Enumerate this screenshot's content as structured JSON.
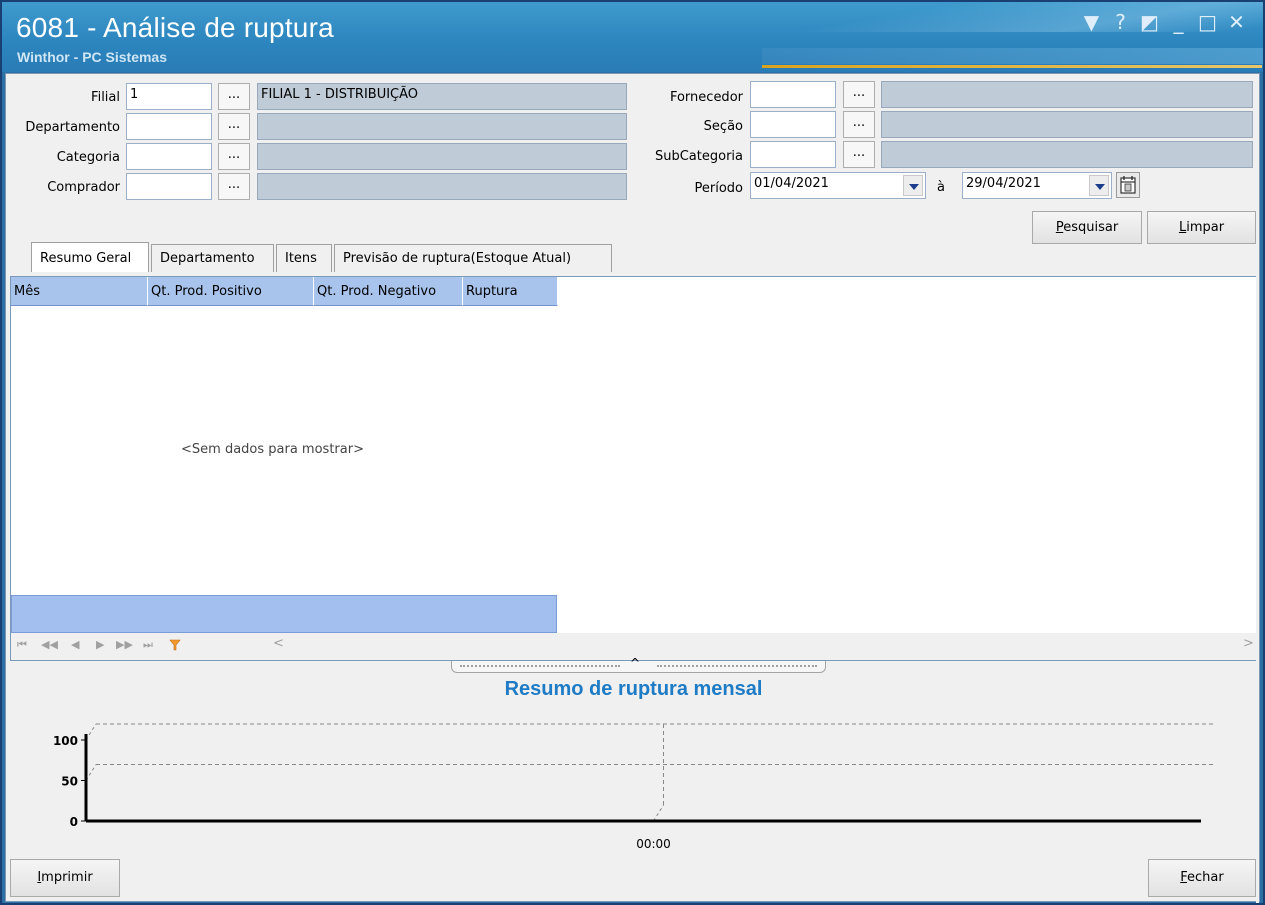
{
  "window": {
    "title": "6081 - Análise de ruptura",
    "subtitle": "Winthor - PC Sistemas",
    "controls": [
      "▼",
      "?",
      "◩",
      "_",
      "□",
      "✕"
    ]
  },
  "form": {
    "filial": {
      "label": "Filial",
      "code": "1",
      "desc": "FILIAL 1 - DISTRIBUIÇÃO",
      "lookup": "..."
    },
    "departamento": {
      "label": "Departamento",
      "code": "",
      "desc": "",
      "lookup": "..."
    },
    "categoria": {
      "label": "Categoria",
      "code": "",
      "desc": "",
      "lookup": "..."
    },
    "comprador": {
      "label": "Comprador",
      "code": "",
      "desc": "",
      "lookup": "..."
    },
    "fornecedor": {
      "label": "Fornecedor",
      "code": "",
      "desc": "",
      "lookup": "..."
    },
    "secao": {
      "label": "Seção",
      "code": "",
      "desc": "",
      "lookup": "..."
    },
    "subcategoria": {
      "label": "SubCategoria",
      "code": "",
      "desc": "",
      "lookup": "..."
    },
    "periodo": {
      "label": "Período",
      "start": "01/04/2021",
      "sep": "à",
      "end": "29/04/2021"
    }
  },
  "buttons": {
    "pesquisar_first": "P",
    "pesquisar_rest": "esquisar",
    "limpar_first": "L",
    "limpar_rest": "impar",
    "imprimir_first": "I",
    "imprimir_rest": "mprimir",
    "fechar_first": "F",
    "fechar_rest": "echar"
  },
  "tabs": [
    "Resumo Geral",
    "Departamento",
    "Itens",
    "Previsão de ruptura(Estoque Atual)"
  ],
  "grid": {
    "columns": [
      "Mês",
      "Qt. Prod. Positivo",
      "Qt. Prod. Negativo",
      "Ruptura"
    ],
    "empty_text": "<Sem dados para mostrar>",
    "nav": [
      "⏮",
      "◀◀",
      "◀",
      "▶",
      "▶▶",
      "⏭"
    ],
    "scroll_left": "<",
    "scroll_right": ">"
  },
  "chart_data": {
    "type": "line",
    "title": "Resumo de ruptura mensal",
    "categories": [
      "00:00"
    ],
    "series": [],
    "yticks": [
      0,
      50,
      100
    ],
    "ylim": [
      0,
      100
    ],
    "grid": true
  },
  "colors": {
    "title_bar": "#2d86bf",
    "grid_header": "#a8c4ec",
    "chart_title": "#1e7bc6",
    "desc_field": "#bfcbd6"
  }
}
